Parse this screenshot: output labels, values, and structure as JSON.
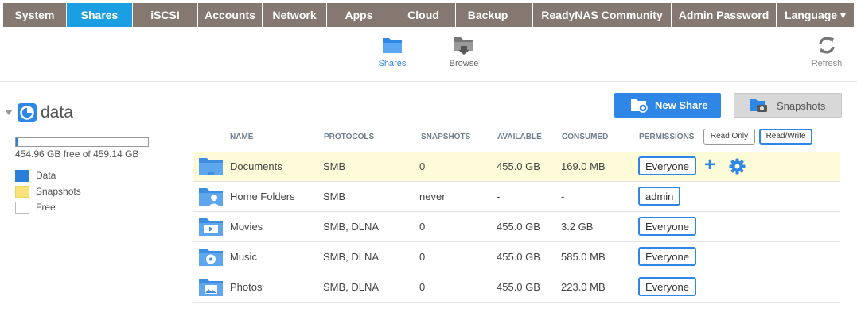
{
  "nav": {
    "tabs": [
      {
        "label": "System"
      },
      {
        "label": "Shares"
      },
      {
        "label": "iSCSI"
      },
      {
        "label": "Accounts"
      },
      {
        "label": "Network"
      },
      {
        "label": "Apps"
      },
      {
        "label": "Cloud"
      },
      {
        "label": "Backup"
      },
      {
        "label": "ReadyNAS Community"
      },
      {
        "label": "Admin Password"
      },
      {
        "label": "Language ▾"
      }
    ],
    "active": "Shares",
    "accent_color": "#1b9ee2",
    "bar_color": "#857870"
  },
  "subnav": {
    "shares_label": "Shares",
    "browse_label": "Browse",
    "refresh_label": "Refresh"
  },
  "volume": {
    "name": "data",
    "usage_text": "454.96 GB free of 459.14 GB",
    "used_fraction": 0.009,
    "legend": [
      {
        "label": "Data",
        "color": "#2b7fd8"
      },
      {
        "label": "Snapshots",
        "color": "#f7e37a"
      },
      {
        "label": "Free",
        "color": "#ffffff"
      }
    ]
  },
  "actions": {
    "new_share": "New Share",
    "snapshots": "Snapshots"
  },
  "table": {
    "headers": {
      "name": "NAME",
      "protocols": "PROTOCOLS",
      "snapshots": "SNAPSHOTS",
      "available": "AVAILABLE",
      "consumed": "CONSUMED",
      "permissions": "PERMISSIONS"
    },
    "perm_options": {
      "read_only": "Read Only",
      "read_write": "Read/Write"
    },
    "rows": [
      {
        "name": "Documents",
        "protocols": "SMB",
        "snapshots": "0",
        "available": "455.0 GB",
        "consumed": "169.0 MB",
        "permission": "Everyone",
        "icon": "folder-icon"
      },
      {
        "name": "Home Folders",
        "protocols": "SMB",
        "snapshots": "never",
        "available": "-",
        "consumed": "-",
        "permission": "admin",
        "icon": "home-folder-icon"
      },
      {
        "name": "Movies",
        "protocols": "SMB, DLNA",
        "snapshots": "0",
        "available": "455.0 GB",
        "consumed": "3.2 GB",
        "permission": "Everyone",
        "icon": "movie-folder-icon"
      },
      {
        "name": "Music",
        "protocols": "SMB, DLNA",
        "snapshots": "0",
        "available": "455.0 GB",
        "consumed": "585.0 MB",
        "permission": "Everyone",
        "icon": "music-folder-icon"
      },
      {
        "name": "Photos",
        "protocols": "SMB, DLNA",
        "snapshots": "0",
        "available": "455.0 GB",
        "consumed": "223.0 MB",
        "permission": "Everyone",
        "icon": "photo-folder-icon"
      }
    ]
  }
}
